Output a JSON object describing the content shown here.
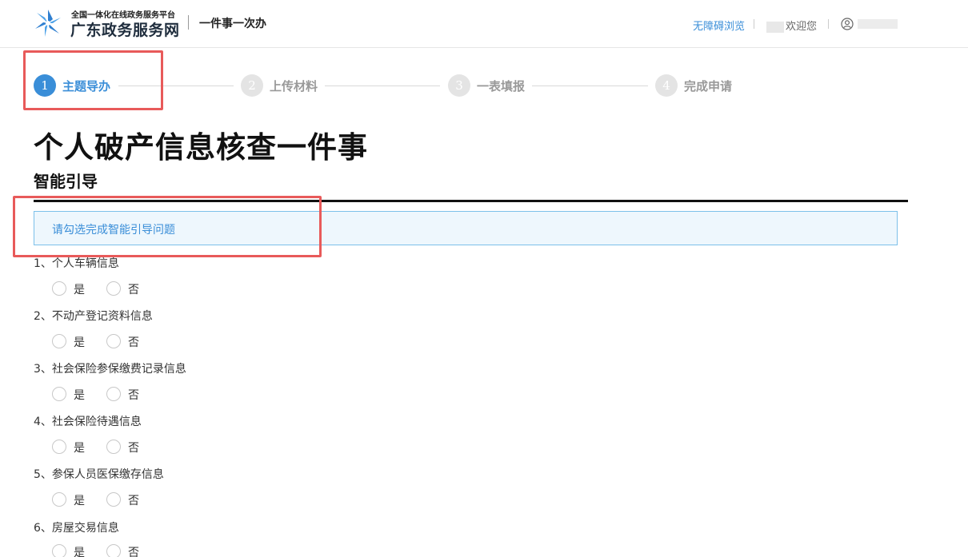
{
  "header": {
    "logo_top": "全国一体化在线政务服务平台",
    "logo_main": "广东政务服务网",
    "logo_sub": "一件事一次办",
    "accessibility": "无障碍浏览",
    "welcome": "欢迎您",
    "logo_icon": "pinwheel-logo-icon",
    "user_icon": "user-icon"
  },
  "steps": [
    {
      "number": "1",
      "label": "主题导办",
      "active": true
    },
    {
      "number": "2",
      "label": "上传材料",
      "active": false
    },
    {
      "number": "3",
      "label": "一表填报",
      "active": false
    },
    {
      "number": "4",
      "label": "完成申请",
      "active": false
    }
  ],
  "page_title": "个人破产信息核查一件事",
  "section_title": "智能引导",
  "notice": "请勾选完成智能引导问题",
  "questions": [
    {
      "label": "1、个人车辆信息",
      "yes": "是",
      "no": "否"
    },
    {
      "label": "2、不动产登记资料信息",
      "yes": "是",
      "no": "否"
    },
    {
      "label": "3、社会保险参保缴费记录信息",
      "yes": "是",
      "no": "否"
    },
    {
      "label": "4、社会保险待遇信息",
      "yes": "是",
      "no": "否"
    },
    {
      "label": "5、参保人员医保缴存信息",
      "yes": "是",
      "no": "否"
    },
    {
      "label": "6、房屋交易信息",
      "yes": "是",
      "no": "否"
    }
  ],
  "colors": {
    "accent": "#3a8ed8",
    "highlight": "#e85a5a",
    "notice_bg": "#eef7fd"
  }
}
